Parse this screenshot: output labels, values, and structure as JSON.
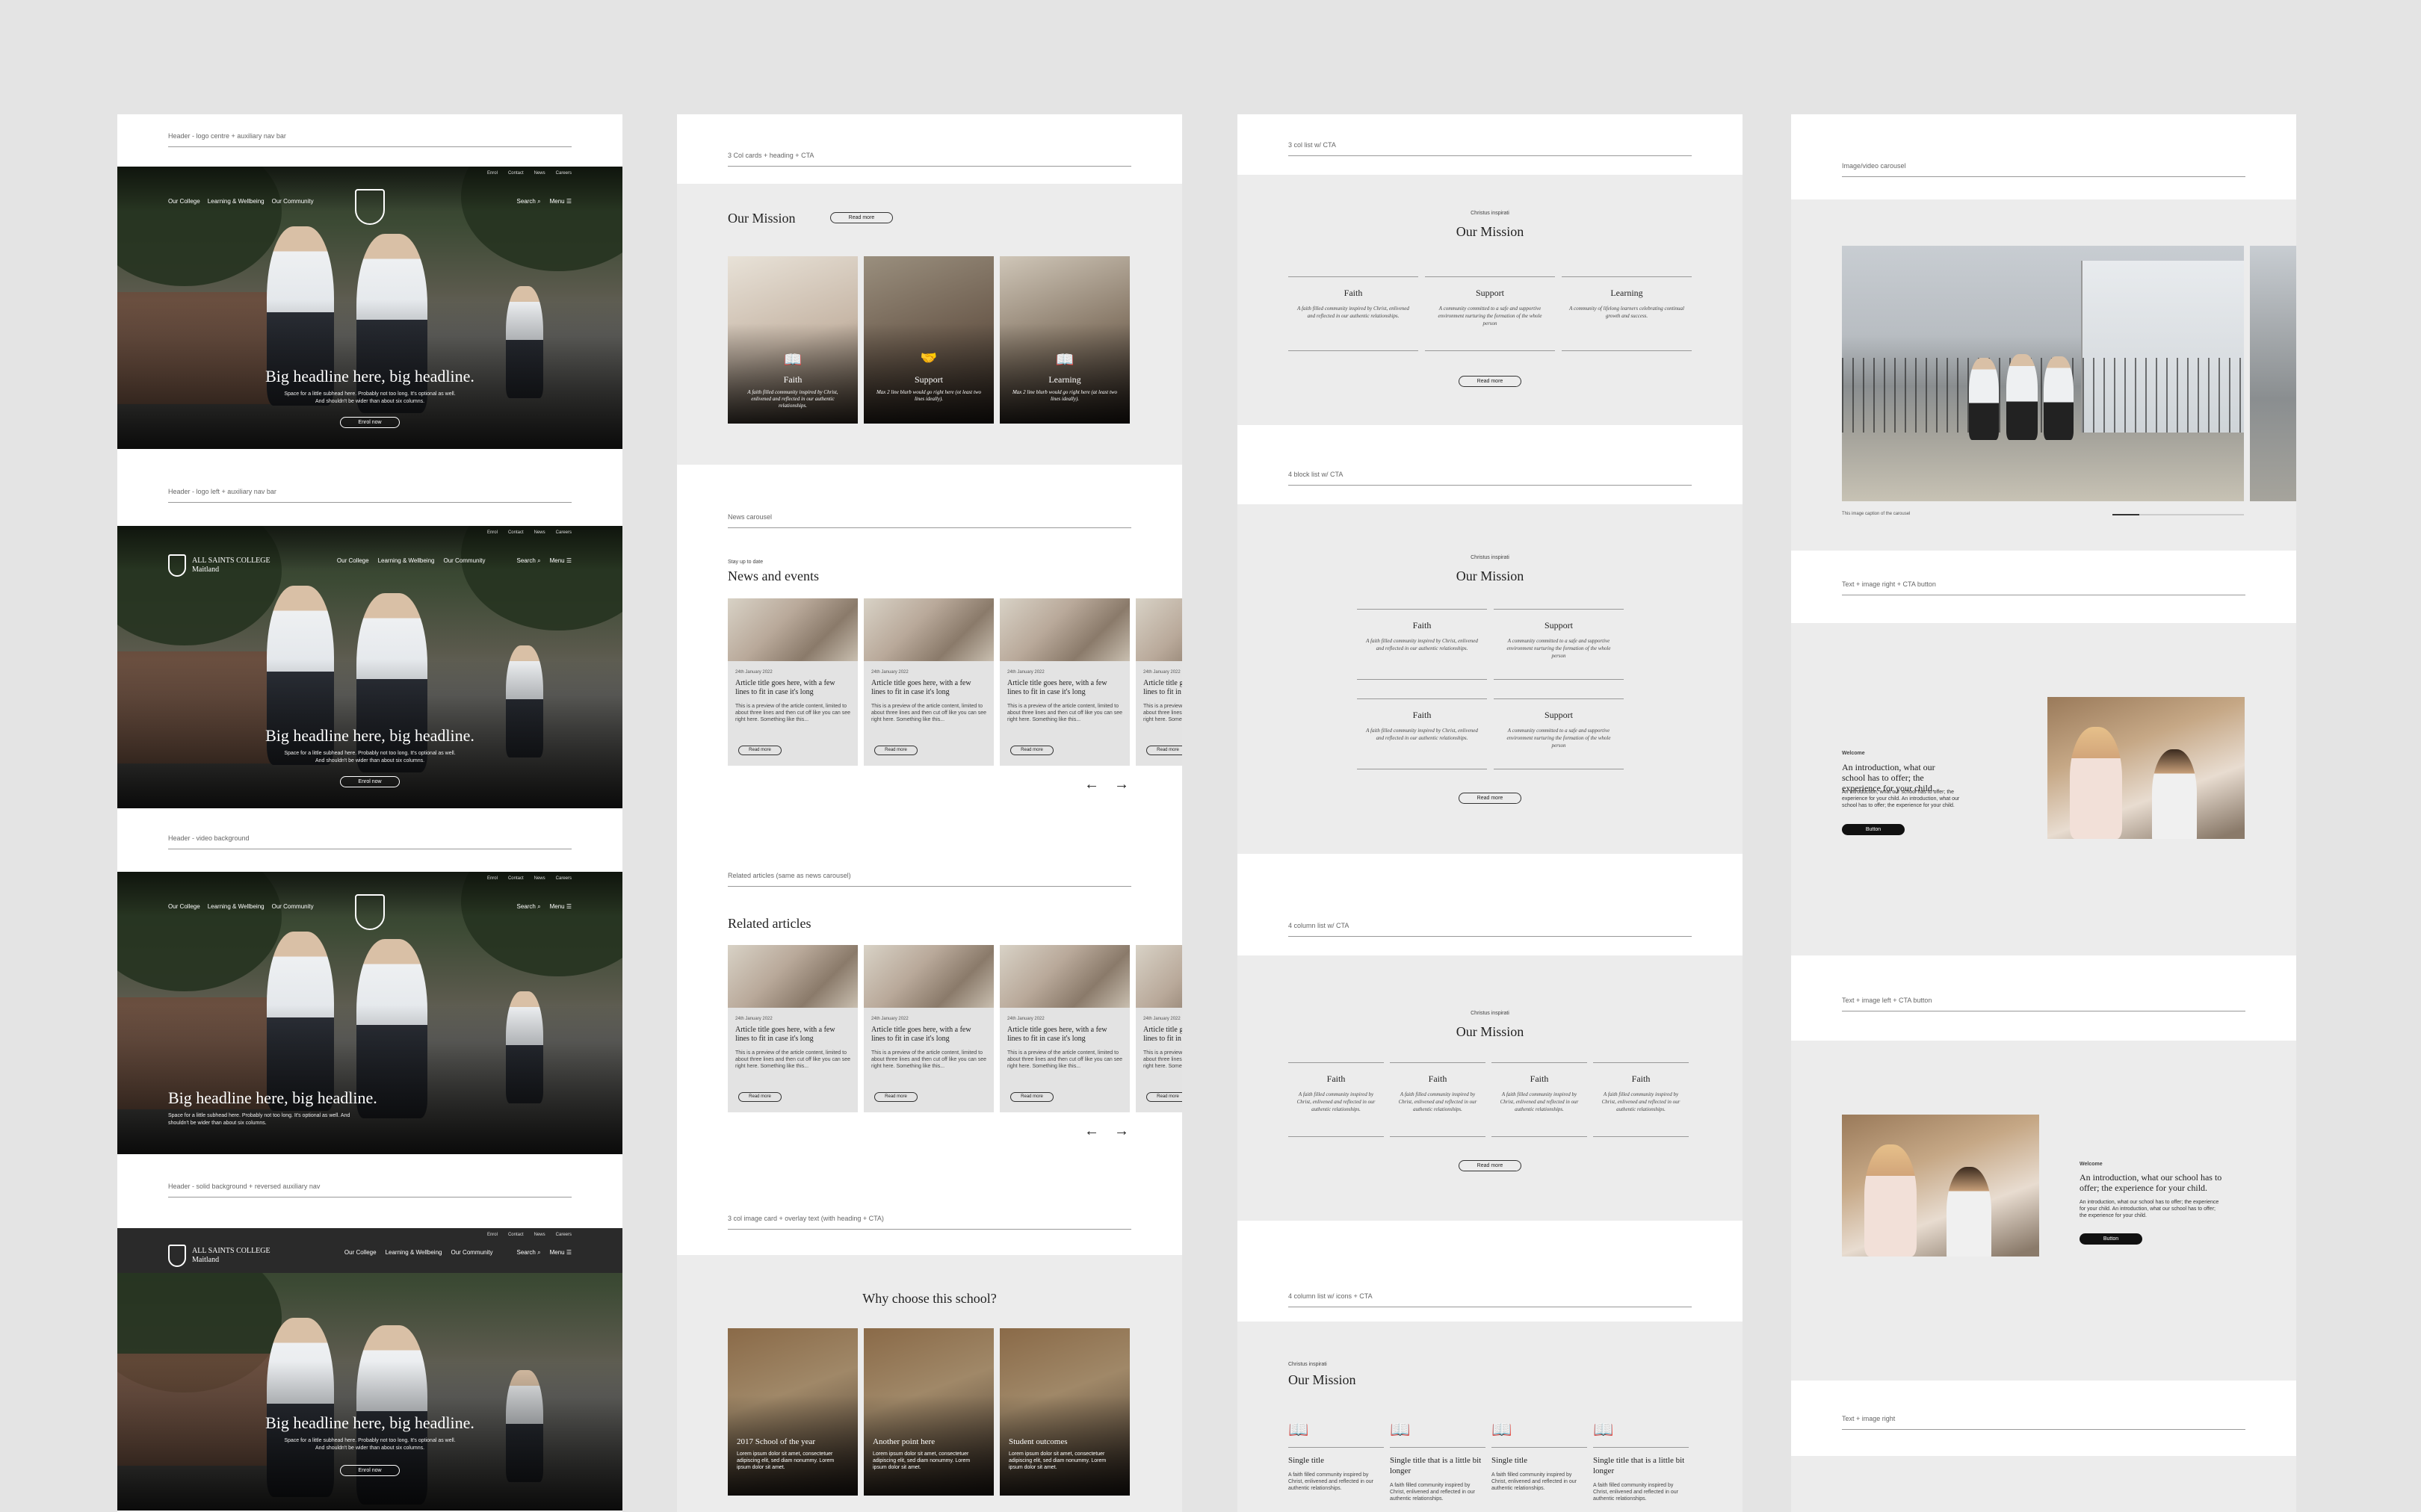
{
  "col1": {
    "label1": "Header - logo centre + auxiliary nav bar",
    "label2": "Header - logo left + auxiliary nav bar",
    "label3": "Header - video background",
    "label4": "Header - solid background + reversed auxiliary nav",
    "aux": [
      "Enrol",
      "Contact",
      "News",
      "Careers"
    ],
    "nav": [
      "Our College",
      "Learning & Wellbeing",
      "Our Community"
    ],
    "search": "Search",
    "menu": "Menu",
    "brand": "ALL SAINTS COLLEGE",
    "brand_sub": "Maitland",
    "headline": "Big headline here, big headline.",
    "sub": "Space for a little subhead here. Probably not too long. It's optional as well. And shouldn't be wider than about six columns.",
    "cta": "Enrol now"
  },
  "col2": {
    "label1": "3 Col cards + heading + CTA",
    "mission": "Our Mission",
    "read_more": "Read more",
    "cards": [
      {
        "t": "Faith",
        "p": "A faith filled community inspired by Christ, enlivened and reflected in our authentic relationships."
      },
      {
        "t": "Support",
        "p": "Max 2 line blurb would go right here (ot least two lines ideally)."
      },
      {
        "t": "Learning",
        "p": "Max 2 line blurb would go right here (at least two lines ideally)."
      }
    ],
    "label2": "News carousel",
    "eyebrow": "Stay up to date",
    "news": "News and events",
    "article_date": "24th January 2022",
    "article_title": "Article title goes here, with a few lines to fit in case it's long",
    "article_text": "This is a preview of the article content, limited to about three lines and then cut off like you can see right here. Something like this...",
    "label3": "Related articles (same as news carousel)",
    "related": "Related articles",
    "label4": "3 col image card + overlay text (with heading + CTA)",
    "why": "Why choose this school?",
    "why_cards": [
      {
        "t": "2017 School of the year",
        "p": "Lorem ipsum dolor sit amet, consectetuer adipiscing elit, sed diam nonummy. Lorem ipsum dolor sit amet."
      },
      {
        "t": "Another point here",
        "p": "Lorem ipsum dolor sit amet, consectetuer adipiscing elit, sed diam nonummy. Lorem ipsum dolor sit amet."
      },
      {
        "t": "Student outcomes",
        "p": "Lorem ipsum dolor sit amet, consectetuer adipiscing elit, sed diam nonummy. Lorem ipsum dolor sit amet."
      }
    ]
  },
  "col3": {
    "label1": "3 col list w/ CTA",
    "eyebrow": "Christus inspirati",
    "mission": "Our Mission",
    "read_more": "Read more",
    "items3": [
      {
        "t": "Faith",
        "p": "A faith filled community inspired by Christ, enlivened and reflected in our authentic relationships."
      },
      {
        "t": "Support",
        "p": "A community committed to a safe and supportive environment nurturing the formation of the whole person"
      },
      {
        "t": "Learning",
        "p": "A community of lifelong learners celebrating continual growth and success."
      }
    ],
    "label2": "4 block list w/ CTA",
    "items4": [
      {
        "t": "Faith",
        "p": "A faith filled community inspired by Christ, enlivened and reflected in our authentic relationships."
      },
      {
        "t": "Support",
        "p": "A community committed to a safe and supportive environment nurturing the formation of the whole person"
      },
      {
        "t": "Faith",
        "p": "A faith filled community inspired by Christ, enlivened and reflected in our authentic relationships."
      },
      {
        "t": "Support",
        "p": "A community committed to a safe and supportive environment nurturing the formation of the whole person"
      }
    ],
    "label3": "4 column list w/ CTA",
    "items4c": [
      {
        "t": "Faith",
        "p": "A faith filled community inspired by Christ, enlivened and reflected in our authentic relationships."
      },
      {
        "t": "Faith",
        "p": "A faith filled community inspired by Christ, enlivened and reflected in our authentic relationships."
      },
      {
        "t": "Faith",
        "p": "A faith filled community inspired by Christ, enlivened and reflected in our authentic relationships."
      },
      {
        "t": "Faith",
        "p": "A faith filled community inspired by Christ, enlivened and reflected in our authentic relationships."
      }
    ],
    "label4": "4 column list w/ icons + CTA",
    "icons": [
      {
        "t": "Single title",
        "p": "A faith filled community inspired by Christ, enlivened and reflected in our authentic relationships."
      },
      {
        "t": "Single title that is a little bit longer",
        "p": "A faith filled community inspired by Christ, enlivened and reflected in our authentic relationships."
      },
      {
        "t": "Single title",
        "p": "A faith filled community inspired by Christ, enlivened and reflected in our authentic relationships."
      },
      {
        "t": "Single title that is a little bit longer",
        "p": "A faith filled community inspired by Christ, enlivened and reflected in our authentic relationships."
      }
    ]
  },
  "col4": {
    "label1": "Image/video carousel",
    "caption": "This image caption of the carousel",
    "label2": "Text + image right + CTA button",
    "welcome": "Welcome",
    "intro": "An introduction, what our school has to offer; the experience for your child.",
    "intro_p": "An introduction, what our school has to offer; the experience for your child. An introduction, what our school has to offer; the experience for your child.",
    "button": "Button",
    "label3": "Text + image left + CTA button",
    "label4": "Text + image right"
  },
  "colors": {
    "bg": "#e4e4e4",
    "band": "#ececec",
    "dark": "#111111"
  }
}
